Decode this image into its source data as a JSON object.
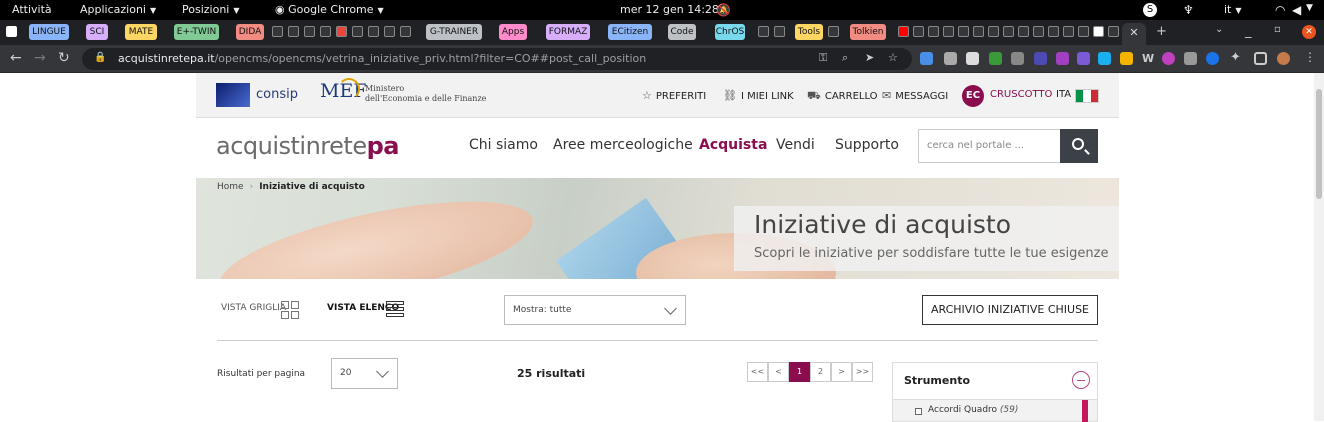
{
  "gnome": {
    "activities": "Attività",
    "applications": "Applicazioni",
    "places": "Posizioni",
    "app": "Google Chrome",
    "datetime": "mer 12 gen  14:28",
    "lang": "it"
  },
  "tabs": [
    {
      "label": "LINGUE",
      "color": "#8ab4f8"
    },
    {
      "label": "SCI",
      "color": "#d7aefb"
    },
    {
      "label": "MATE",
      "color": "#fdd663"
    },
    {
      "label": "E+-TWIN",
      "color": "#81c995"
    },
    {
      "label": "DIDA",
      "color": "#f28b82"
    },
    {
      "label": "G-TRAINER",
      "color": "#bdc1c6"
    },
    {
      "label": "Apps",
      "color": "#ff8bcb"
    },
    {
      "label": "FORMAZ",
      "color": "#d7aefb"
    },
    {
      "label": "ECitizen",
      "color": "#8ab4f8"
    },
    {
      "label": "Code",
      "color": "#bdc1c6"
    },
    {
      "label": "ChrOS",
      "color": "#78d9ec"
    },
    {
      "label": "Tools",
      "color": "#fdd663"
    },
    {
      "label": "Tolkien",
      "color": "#f28b82"
    }
  ],
  "toolbar": {
    "url_host": "acquistinretepa.it",
    "url_path": "/opencms/opencms/vetrina_iniziative_priv.html?filter=CO##post_call_position"
  },
  "utility": {
    "consip": "consip",
    "mef": "MEF",
    "mef_sub": [
      "Ministero",
      "dell'Economia e delle Finanze"
    ],
    "preferiti": "PREFERITI",
    "miei_link": "I MIEI LINK",
    "carrello": "CARRELLO",
    "messaggi": "MESSAGGI",
    "initials": "EC",
    "cruscotto": "CRUSCOTTO",
    "lang": "ITA"
  },
  "nav": {
    "brand_a": "acquistinrete",
    "brand_b": "pa",
    "items": [
      "Chi siamo",
      "Aree merceologiche",
      "Acquista",
      "Vendi",
      "Supporto"
    ],
    "search_placeholder": "cerca nel portale ..."
  },
  "hero": {
    "crumb_home": "Home",
    "crumb_current": "Iniziative di acquisto",
    "title": "Iniziative di acquisto",
    "subtitle": "Scopri le iniziative per soddisfare tutte le tue esigenze"
  },
  "controls": {
    "vista_griglia": "VISTA GRIGLIA",
    "vista_elenco": "VISTA ELENCO",
    "mostra": "Mostra: tutte",
    "archivio": "ARCHIVIO INIZIATIVE CHIUSE",
    "risultati_per_pagina": "Risultati per pagina",
    "per_page": "20",
    "results": "25 risultati"
  },
  "pagination": [
    "<<",
    "<",
    "1",
    "2",
    ">",
    ">>"
  ],
  "facet": {
    "title": "Strumento",
    "option": "Accordi Quadro",
    "count": "(59)"
  }
}
